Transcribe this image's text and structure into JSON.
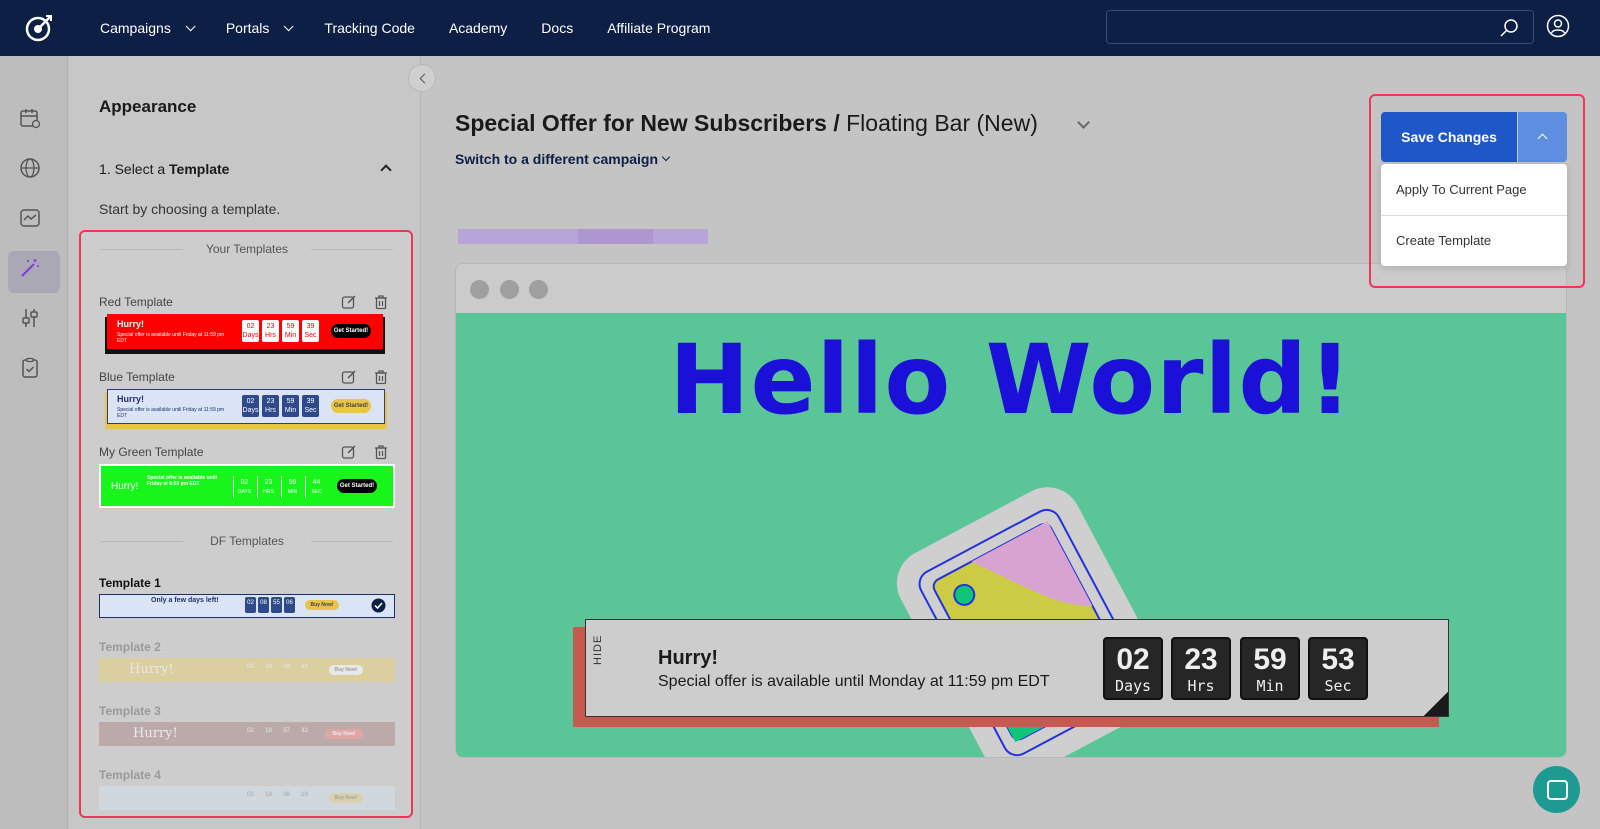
{
  "nav": {
    "items": [
      {
        "label": "Campaigns",
        "dropdown": true
      },
      {
        "label": "Portals",
        "dropdown": true
      },
      {
        "label": "Tracking Code",
        "dropdown": false
      },
      {
        "label": "Academy",
        "dropdown": false
      },
      {
        "label": "Docs",
        "dropdown": false
      },
      {
        "label": "Affiliate Program",
        "dropdown": false
      }
    ],
    "search_placeholder": ""
  },
  "panel": {
    "title": "Appearance",
    "step_prefix": "1. Select a ",
    "step_bold": "Template",
    "step_desc": "Start by choosing a template.",
    "your_templates_title": "Your Templates",
    "df_templates_title": "DF Templates",
    "your_templates": [
      {
        "label": "Red Template",
        "hurry": "Hurry!",
        "text": "Special offer is available until Friday at 11:59 pm EDT",
        "counts": [
          "02",
          "23",
          "59",
          "39"
        ],
        "units": [
          "Days",
          "Hrs",
          "Min",
          "Sec"
        ],
        "cta": "Get Started!",
        "bg": "#ff0000"
      },
      {
        "label": "Blue Template",
        "hurry": "Hurry!",
        "text": "Special offer is available until Friday at 11:59 pm EDT",
        "counts": [
          "02",
          "23",
          "59",
          "39"
        ],
        "units": [
          "Days",
          "Hrs",
          "Min",
          "Sec"
        ],
        "cta": "Get Started!",
        "bg": "#dbe4f5"
      },
      {
        "label": "My Green Template",
        "hurry": "Hurry!",
        "text": "Special offer is available until Friday at 6:59 pm EDT",
        "counts": [
          "02",
          "23",
          "59",
          "44"
        ],
        "units": [
          "DAYS",
          "HRS",
          "MIN",
          "SEC"
        ],
        "cta": "Get Started!",
        "bg": "#17f51b"
      }
    ],
    "df_templates": [
      {
        "label": "Template 1",
        "hurry": "Only a few days left!",
        "counts": [
          "02",
          "08",
          "55",
          "06"
        ],
        "cta": "Buy Now!",
        "selected": true
      },
      {
        "label": "Template 2",
        "hurry": "Hurry!",
        "counts": [
          "02",
          "18",
          "38",
          "41"
        ],
        "cta": "Buy Now!",
        "selected": false
      },
      {
        "label": "Template 3",
        "hurry": "Hurry!",
        "counts": [
          "02",
          "18",
          "57",
          "32"
        ],
        "cta": "Buy Now!",
        "selected": false
      },
      {
        "label": "Template 4",
        "hurry": "",
        "counts": [
          "02",
          "18",
          "38",
          "19"
        ],
        "cta": "Buy Now!",
        "selected": false
      }
    ]
  },
  "main": {
    "campaign_name": "Special Offer for New Subscribers",
    "separator": " / ",
    "variant_name": "Floating Bar (New)",
    "switch_label": "Switch to a different campaign",
    "preview_heading": "Hello World!"
  },
  "floating_bar": {
    "hide_label": "HIDE",
    "hurry": "Hurry!",
    "offer": "Special offer is available until Monday at 11:59 pm EDT",
    "countdown": [
      {
        "value": "02",
        "unit": "Days"
      },
      {
        "value": "23",
        "unit": "Hrs"
      },
      {
        "value": "59",
        "unit": "Min"
      },
      {
        "value": "53",
        "unit": "Sec"
      }
    ]
  },
  "save": {
    "label": "Save Changes",
    "menu": [
      "Apply To Current Page",
      "Create Template"
    ]
  },
  "colors": {
    "nav_bg": "#0d1f45",
    "save_btn": "#1f57c8",
    "highlight": "#f0345a",
    "preview_bg": "#5ac596",
    "hello": "#1a10d8"
  }
}
